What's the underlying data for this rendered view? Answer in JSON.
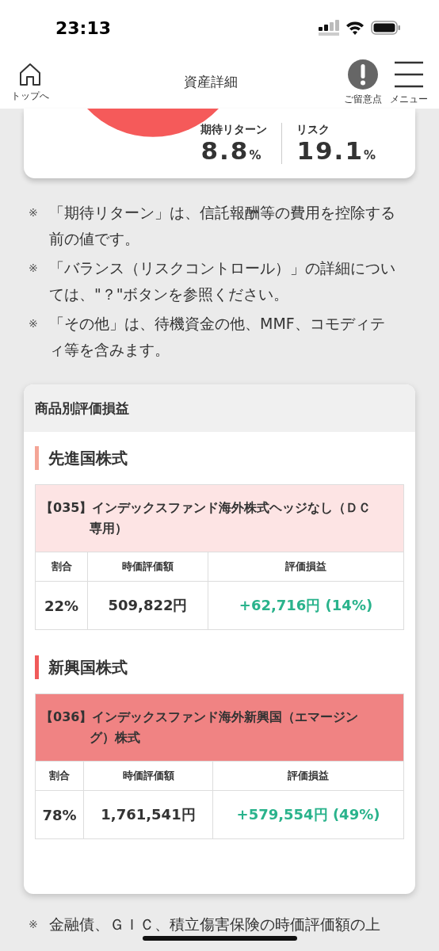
{
  "status_bar": {
    "time": "23:13"
  },
  "header": {
    "home": {
      "label": "トップへ"
    },
    "title": "資産詳細",
    "actions": [
      {
        "kind": "alert",
        "label": "ご留意点"
      },
      {
        "kind": "menu",
        "label": "メニュー"
      }
    ]
  },
  "summary_card": {
    "metrics": [
      {
        "label": "期待リターン",
        "value": "8.8",
        "unit": "%"
      },
      {
        "label": "リスク",
        "value": "19.1",
        "unit": "%"
      }
    ]
  },
  "notes": [
    {
      "mark": "※",
      "text": "「期待リターン」は、信託報酬等の費用を控除する前の値です。"
    },
    {
      "mark": "※",
      "text": "「バランス（リスクコントロール）」の詳細については、\"？\"ボタンを参照ください。"
    },
    {
      "mark": "※",
      "text": "「その他」は、待機資金の他、MMF、コモディティ等を含みます。"
    }
  ],
  "valuation_card": {
    "title": "商品別評価損益",
    "sections": [
      {
        "title": "先進国株式",
        "color": "#f4a596",
        "fund": {
          "name": "【035】インデックスファンド海外株式ヘッジなし（ＤＣ専用）",
          "color": "#fde4e4"
        },
        "columns": [
          "割合",
          "時価評価額",
          "評価損益"
        ],
        "row": [
          "22%",
          "509,822円",
          "+62,716円 (14%)"
        ]
      },
      {
        "title": "新興国株式",
        "color": "#f05a5a",
        "fund": {
          "name": "【036】インデックスファンド海外新興国（エマージング）株式",
          "color": "#f08383"
        },
        "columns": [
          "割合",
          "時価評価額",
          "評価損益"
        ],
        "row": [
          "78%",
          "1,761,541円",
          "+579,554円 (49%)"
        ]
      }
    ]
  },
  "footer_note": {
    "mark": "※",
    "text": "金融債、ＧＩＣ、積立傷害保険の時価評価額の上"
  }
}
